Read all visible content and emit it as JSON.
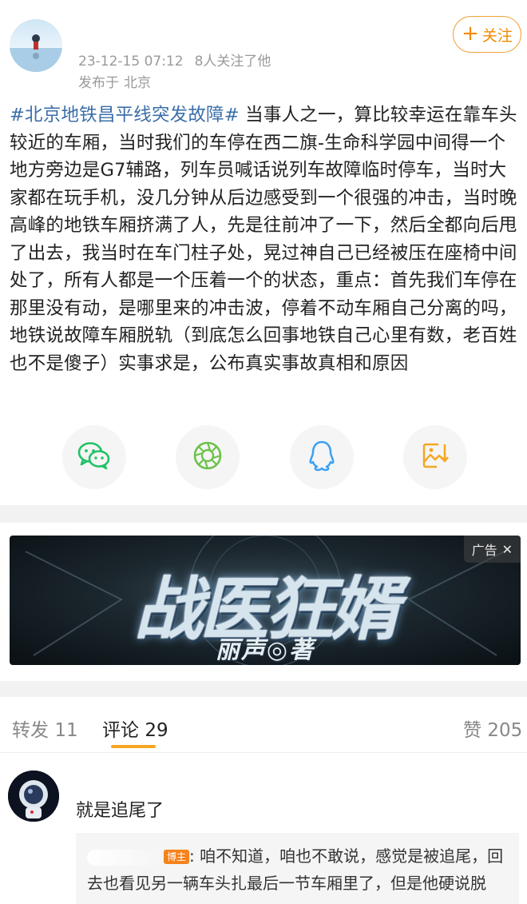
{
  "post": {
    "follow_label": "关注",
    "date": "23-12-15 07:12",
    "followers_note": "8人关注了他",
    "location_prefix": "发布于",
    "location": "北京",
    "hashtag": "#北京地铁昌平线突发故障#",
    "body": " 当事人之一，算比较幸运在靠车头较近的车厢，当时我们的车停在西二旗-生命科学园中间得一个地方旁边是G7辅路，列车员喊话说列车故障临时停车，当时大家都在玩手机，没几分钟从后边感受到一个很强的冲击，当时晚高峰的地铁车厢挤满了人，先是往前冲了一下，然后全都向后甩了出去，我当时在车门柱子处，晃过神自己已经被压在座椅中间处了，所有人都是一个压着一个的状态，重点：首先我们车停在那里没有动，是哪里来的冲击波，停着不动车厢自己分离的吗，地铁说故障车厢脱轨（到底怎么回事地铁自己心里有数，老百姓也不是傻子）实事求是，公布真实事故真相和原因"
  },
  "share": {
    "icons": [
      "wechat-icon",
      "moments-icon",
      "qq-icon",
      "save-image-icon"
    ]
  },
  "ad": {
    "title": "战医狂婿",
    "author": "丽声◎著",
    "badge": "广告"
  },
  "tabs": {
    "repost_label": "转发",
    "repost_count": "11",
    "comment_label": "评论",
    "comment_count": "29",
    "like_label": "赞",
    "like_count": "205"
  },
  "comment": {
    "text": "就是追尾了",
    "owner_badge": "博主",
    "reply_text": ": 咱不知道，咱也不敢说，感觉是被追尾，回去也看见另一辆车头扎最后一节车厢里了，但是他硬说脱"
  },
  "colors": {
    "accent": "#f5a623",
    "hashtag": "#3b6fa8",
    "follow": "#f08a00",
    "wechat": "#21c266",
    "moments": "#6cc24a",
    "qq": "#3aa0f2",
    "save": "#f5a623"
  }
}
